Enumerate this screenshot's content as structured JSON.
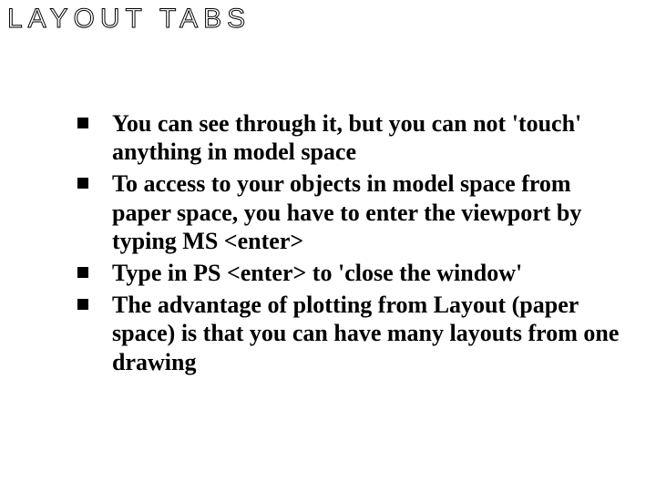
{
  "title": "LAYOUT TABS",
  "bullets": {
    "b1": "You can see through it, but you can not 'touch' anything in model space",
    "b2": "To access to your objects in model space  from paper space, you have to enter the  viewport by typing MS <enter>",
    "b3": "Type in PS <enter> to 'close the window'",
    "b4": "The advantage of plotting from Layout (paper space) is that you can have many layouts from one drawing"
  }
}
